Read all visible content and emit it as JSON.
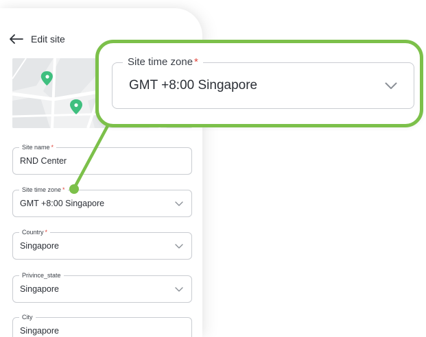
{
  "header": {
    "title": "Edit site"
  },
  "form": {
    "site_name": {
      "label": "Site name",
      "value": "RND Center",
      "required": "*"
    },
    "time_zone": {
      "label": "Site time zone",
      "value": "GMT +8:00 Singapore",
      "required": "*"
    },
    "country": {
      "label": "Country",
      "value": "Singapore",
      "required": "*"
    },
    "province": {
      "label": "Privince_state",
      "value": "Singapore"
    },
    "city": {
      "label": "City",
      "value": "Singapore"
    }
  },
  "callout": {
    "label": "Site time zone",
    "required": "*",
    "value": "GMT +8:00 Singapore"
  },
  "colors": {
    "accent_green": "#7cc04a",
    "map_pin": "#3fbf7f",
    "required": "#e0463c",
    "border": "#c9ccd1"
  },
  "icons": {
    "back": "arrow-left-icon",
    "dropdown": "chevron-down-icon",
    "pin": "map-pin-icon"
  }
}
